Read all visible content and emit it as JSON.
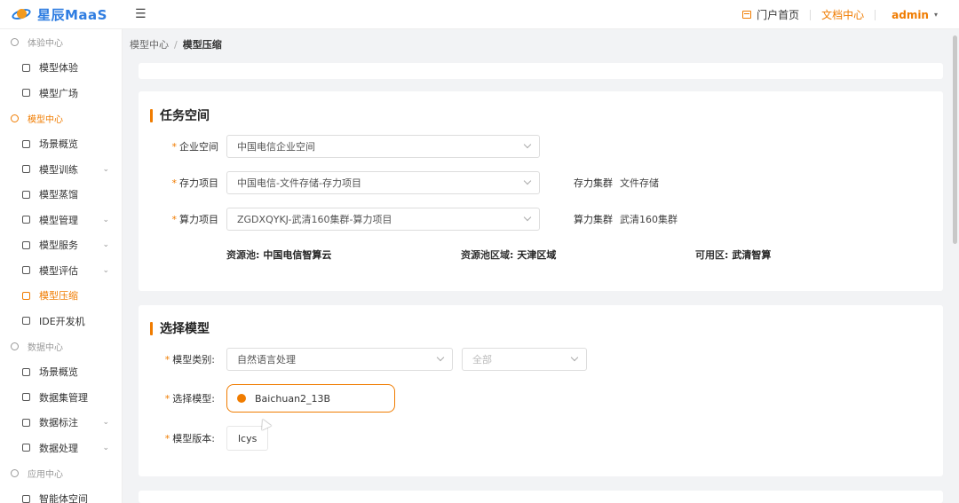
{
  "app": {
    "logo_text": "星辰MaaS",
    "menu_toggle": "☰"
  },
  "topnav": {
    "portal": "门户首页",
    "docs": "文档中心",
    "user": "admin",
    "caret": "▾"
  },
  "sidebar": {
    "groups": [
      {
        "title": "体验中心",
        "items": [
          {
            "label": "模型体验"
          },
          {
            "label": "模型广场"
          }
        ]
      },
      {
        "title": "模型中心",
        "items": [
          {
            "label": "场景概览"
          },
          {
            "label": "模型训练",
            "chev": "⌄"
          },
          {
            "label": "模型蒸馏"
          },
          {
            "label": "模型管理",
            "chev": "⌄"
          },
          {
            "label": "模型服务",
            "chev": "⌄"
          },
          {
            "label": "模型评估",
            "chev": "⌄"
          },
          {
            "label": "模型压缩"
          },
          {
            "label": "IDE开发机"
          }
        ]
      },
      {
        "title": "数据中心",
        "items": [
          {
            "label": "场景概览"
          },
          {
            "label": "数据集管理"
          },
          {
            "label": "数据标注",
            "chev": "⌄"
          },
          {
            "label": "数据处理",
            "chev": "⌄"
          }
        ]
      },
      {
        "title": "应用中心",
        "items": [
          {
            "label": "智能体空间"
          }
        ]
      }
    ]
  },
  "breadcrumb": {
    "root": "模型中心",
    "separator": "/",
    "current": "模型压缩"
  },
  "task_space": {
    "title": "任务空间",
    "required_mark": "*",
    "enterprise": {
      "label": "企业空间",
      "value": "中国电信企业空间"
    },
    "storage": {
      "label": "存力项目",
      "value": "中国电信-文件存储-存力项目",
      "cluster_label": "存力集群",
      "cluster_value": "文件存储"
    },
    "compute": {
      "label": "算力项目",
      "value": "ZGDXQYKJ-武清160集群-算力项目",
      "cluster_label": "算力集群",
      "cluster_value": "武清160集群"
    },
    "pool": {
      "label": "资源池:",
      "value": "中国电信智算云"
    },
    "region": {
      "label": "资源池区域:",
      "value": "天津区域"
    },
    "zone": {
      "label": "可用区:",
      "value": "武清智算"
    }
  },
  "select_model": {
    "title": "选择模型",
    "category": {
      "label": "模型类别:",
      "value": "自然语言处理",
      "sub_placeholder": "全部"
    },
    "model": {
      "label": "选择模型:",
      "value": "Baichuan2_13B"
    },
    "version": {
      "label": "模型版本:",
      "value": "lcys"
    }
  },
  "colors": {
    "accent": "#f07c00",
    "logo_blue": "#2f7de1"
  }
}
